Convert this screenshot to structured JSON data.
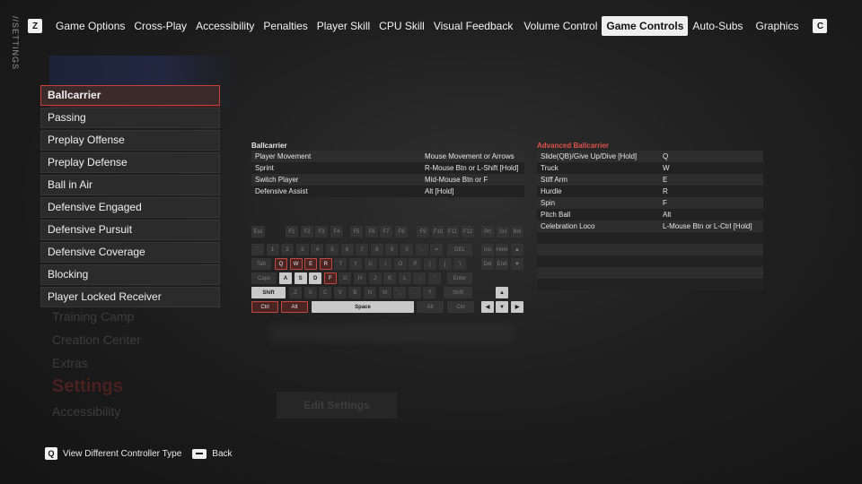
{
  "side_label": "//SETTINGS",
  "nav": {
    "left_key": "Z",
    "right_key": "C",
    "tabs": [
      "Game Options",
      "Cross-Play",
      "Accessibility",
      "Penalties",
      "Player Skill",
      "CPU Skill",
      "Visual Feedback",
      "Volume Control",
      "Game Controls",
      "Auto-Subs",
      "Graphics"
    ],
    "active_tab": "Game Controls"
  },
  "categories": [
    "Ballcarrier",
    "Passing",
    "Preplay Offense",
    "Preplay Defense",
    "Ball in Air",
    "Defensive Engaged",
    "Defensive Pursuit",
    "Defensive Coverage",
    "Blocking",
    "Player Locked Receiver"
  ],
  "active_category": "Ballcarrier",
  "bindings": {
    "title": "Ballcarrier",
    "rows": [
      {
        "action": "Player Movement",
        "key": "Mouse Movement or Arrows"
      },
      {
        "action": "Sprint",
        "key": "R-Mouse Btn or L-Shift [Hold]"
      },
      {
        "action": "Switch Player",
        "key": "Mid-Mouse Btn or F"
      },
      {
        "action": "Defensive Assist",
        "key": "Alt [Hold]"
      }
    ]
  },
  "advanced": {
    "title": "Advanced Ballcarrier",
    "rows": [
      {
        "action": "Slide(QB)/Give Up/Dive [Hold]",
        "key": "Q"
      },
      {
        "action": "Truck",
        "key": "W"
      },
      {
        "action": "Stiff Arm",
        "key": "E"
      },
      {
        "action": "Hurdle",
        "key": "R"
      },
      {
        "action": "Spin",
        "key": "F"
      },
      {
        "action": "Pitch Ball",
        "key": "Alt"
      },
      {
        "action": "Celebration Loco",
        "key": "L-Mouse Btn or L-Ctrl [Hold]"
      },
      {
        "action": "",
        "key": ""
      },
      {
        "action": "",
        "key": ""
      },
      {
        "action": "",
        "key": ""
      },
      {
        "action": "",
        "key": ""
      },
      {
        "action": "",
        "key": ""
      }
    ]
  },
  "keyboard": {
    "row1": [
      "Esc",
      "F1",
      "F2",
      "F3",
      "F4",
      "F5",
      "F6",
      "F7",
      "F8",
      "F9",
      "F10",
      "F11",
      "F12",
      "Prt",
      "Scl",
      "Brk"
    ],
    "row2": [
      "`",
      "1",
      "2",
      "3",
      "4",
      "5",
      "6",
      "7",
      "8",
      "9",
      "0",
      "-",
      "=",
      "DEL",
      "Ins",
      "Hom",
      "▲"
    ],
    "row3": [
      "Tab",
      "Q",
      "W",
      "E",
      "R",
      "T",
      "Y",
      "U",
      "I",
      "O",
      "P",
      "[",
      "]",
      "\\",
      "Del",
      "End",
      "▼"
    ],
    "row4": [
      "Caps",
      "A",
      "S",
      "D",
      "F",
      "G",
      "H",
      "J",
      "K",
      "L",
      ";",
      "'",
      "Enter"
    ],
    "row5": [
      "Shift",
      "Z",
      "X",
      "C",
      "V",
      "B",
      "N",
      "M",
      ",",
      ".",
      "?",
      "Shift",
      "▲"
    ],
    "row6": [
      "Ctrl",
      "Alt",
      "Space",
      "Alt",
      "Ctrl",
      "◀",
      "▼",
      "▶"
    ],
    "highlighted": [
      "Q",
      "W",
      "E",
      "R",
      "F",
      "Ctrl",
      "Alt"
    ],
    "white": [
      "A",
      "S",
      "D",
      "Shift",
      "Space",
      "arrows"
    ]
  },
  "background": {
    "menu": [
      "Training Camp",
      "Creation Center",
      "Extras",
      "Settings",
      "Accessibility"
    ],
    "edit_button": "Edit Settings"
  },
  "footer": {
    "controller_key": "Q",
    "controller_label": "View Different Controller Type",
    "back_label": "Back"
  },
  "colors": {
    "accent_red": "#c8403d",
    "title_red": "#e0504a",
    "active_tab_bg": "#efefef"
  }
}
